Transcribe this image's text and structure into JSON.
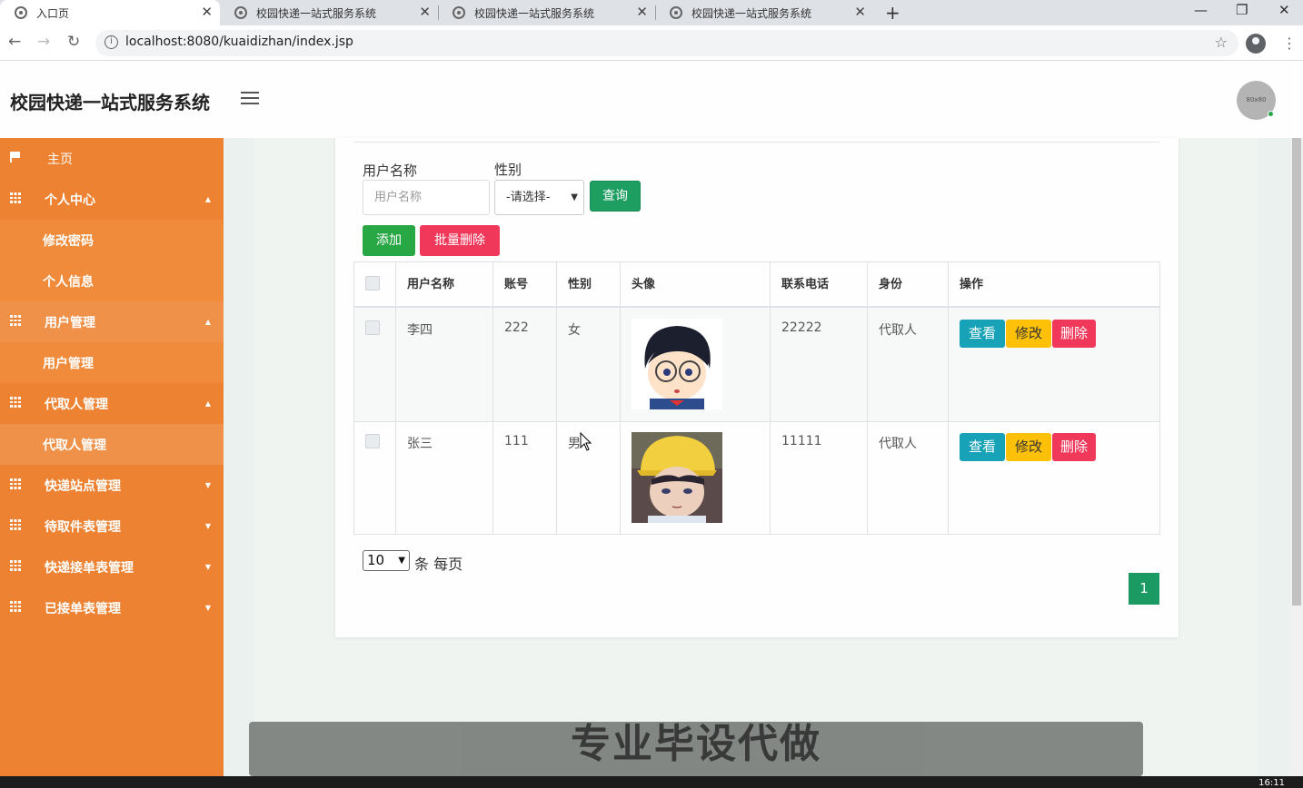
{
  "browser": {
    "tabs": [
      {
        "title": "入口页",
        "active": true
      },
      {
        "title": "校园快递一站式服务系统",
        "active": false
      },
      {
        "title": "校园快递一站式服务系统",
        "active": false
      },
      {
        "title": "校园快递一站式服务系统",
        "active": false
      }
    ],
    "url": "localhost:8080/kuaidizhan/index.jsp"
  },
  "header": {
    "title": "校园快递一站式服务系统",
    "avatar_label": "80x80"
  },
  "sidebar": {
    "items": [
      {
        "label": "主页",
        "icon": "flag-icon"
      },
      {
        "label": "个人中心",
        "icon": "grid-icon",
        "caret": "▲"
      },
      {
        "label": "修改密码"
      },
      {
        "label": "个人信息"
      },
      {
        "label": "用户管理",
        "icon": "grid-icon",
        "caret": "▲"
      },
      {
        "label": "用户管理"
      },
      {
        "label": "代取人管理",
        "icon": "grid-icon",
        "caret": "▲"
      },
      {
        "label": "代取人管理"
      },
      {
        "label": "快递站点管理",
        "icon": "grid-icon",
        "caret": "▼"
      },
      {
        "label": "待取件表管理",
        "icon": "grid-icon",
        "caret": "▼"
      },
      {
        "label": "快递接单表管理",
        "icon": "grid-icon",
        "caret": "▼"
      },
      {
        "label": "已接单表管理",
        "icon": "grid-icon",
        "caret": "▼"
      }
    ]
  },
  "search": {
    "username_label": "用户名称",
    "username_placeholder": "用户名称",
    "gender_label": "性别",
    "gender_selected": "-请选择-",
    "query_button": "查询"
  },
  "toolbar": {
    "add_button": "添加",
    "batch_delete_button": "批量删除"
  },
  "table": {
    "headers": [
      "用户名称",
      "账号",
      "性别",
      "头像",
      "联系电话",
      "身份",
      "操作"
    ],
    "rows": [
      {
        "name": "李四",
        "account": "222",
        "gender": "女",
        "phone": "22222",
        "role": "代取人"
      },
      {
        "name": "张三",
        "account": "111",
        "gender": "男",
        "phone": "11111",
        "role": "代取人"
      }
    ],
    "actions": {
      "view": "查看",
      "edit": "修改",
      "delete": "删除"
    }
  },
  "pagination": {
    "page_size": "10",
    "page_size_suffix": "条 每页",
    "current_page": "1"
  },
  "banner": {
    "text": "专业毕设代做"
  },
  "taskbar": {
    "clock": "16:11"
  },
  "colors": {
    "sidebar": "#ed8332",
    "primary_green": "#1b9a63",
    "danger": "#f0385b",
    "warning": "#ffc107",
    "info": "#17a2b8"
  }
}
